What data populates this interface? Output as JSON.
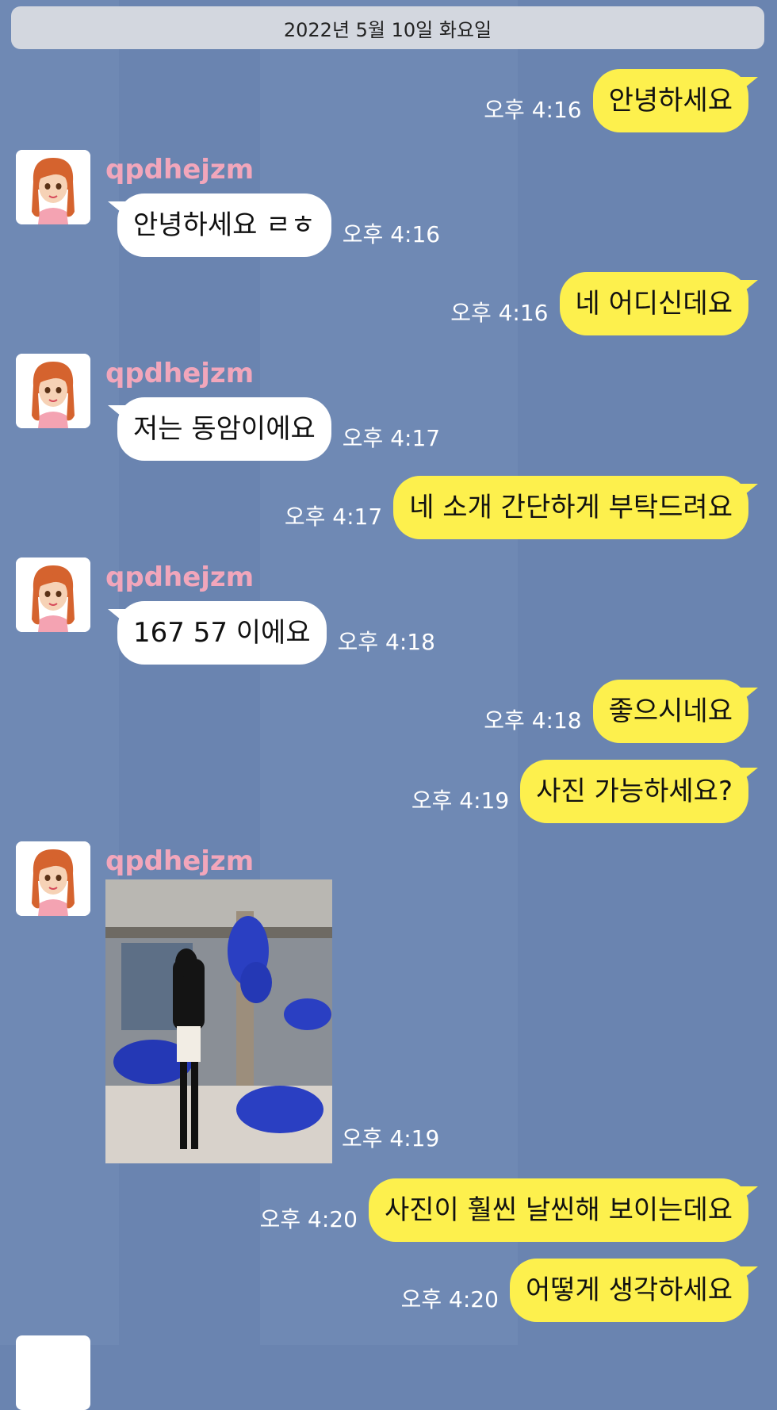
{
  "date_bar": "2022년 5월 10일 화요일",
  "sender_name": "qpdhejzm",
  "messages": [
    {
      "text": "안녕하세요",
      "time": "오후 4:16"
    },
    {
      "text": "안녕하세요 ㄹㅎ",
      "time": "오후 4:16"
    },
    {
      "text": "네 어디신데요",
      "time": "오후 4:16"
    },
    {
      "text": "저는 동암이에요",
      "time": "오후 4:17"
    },
    {
      "text": "네  소개 간단하게 부탁드려요",
      "time": "오후 4:17"
    },
    {
      "text": "167 57 이에요",
      "time": "오후 4:18"
    },
    {
      "text": "좋으시네요",
      "time": "오후 4:18"
    },
    {
      "text": "사진 가능하세요?",
      "time": "오후 4:19"
    },
    {
      "text": "",
      "time": "오후 4:19"
    },
    {
      "text": "사진이 훨씬 날씬해 보이는데요",
      "time": "오후 4:20"
    },
    {
      "text": "어떻게 생각하세요",
      "time": "오후 4:20"
    }
  ],
  "colors": {
    "background": "#6a84b0",
    "my_bubble": "#fdf04d",
    "their_bubble": "#ffffff",
    "sender_name": "#f2a6bb",
    "date_bar": "#d3d7df"
  },
  "icons": {
    "avatar": "cartoon-girl-avatar-icon"
  }
}
